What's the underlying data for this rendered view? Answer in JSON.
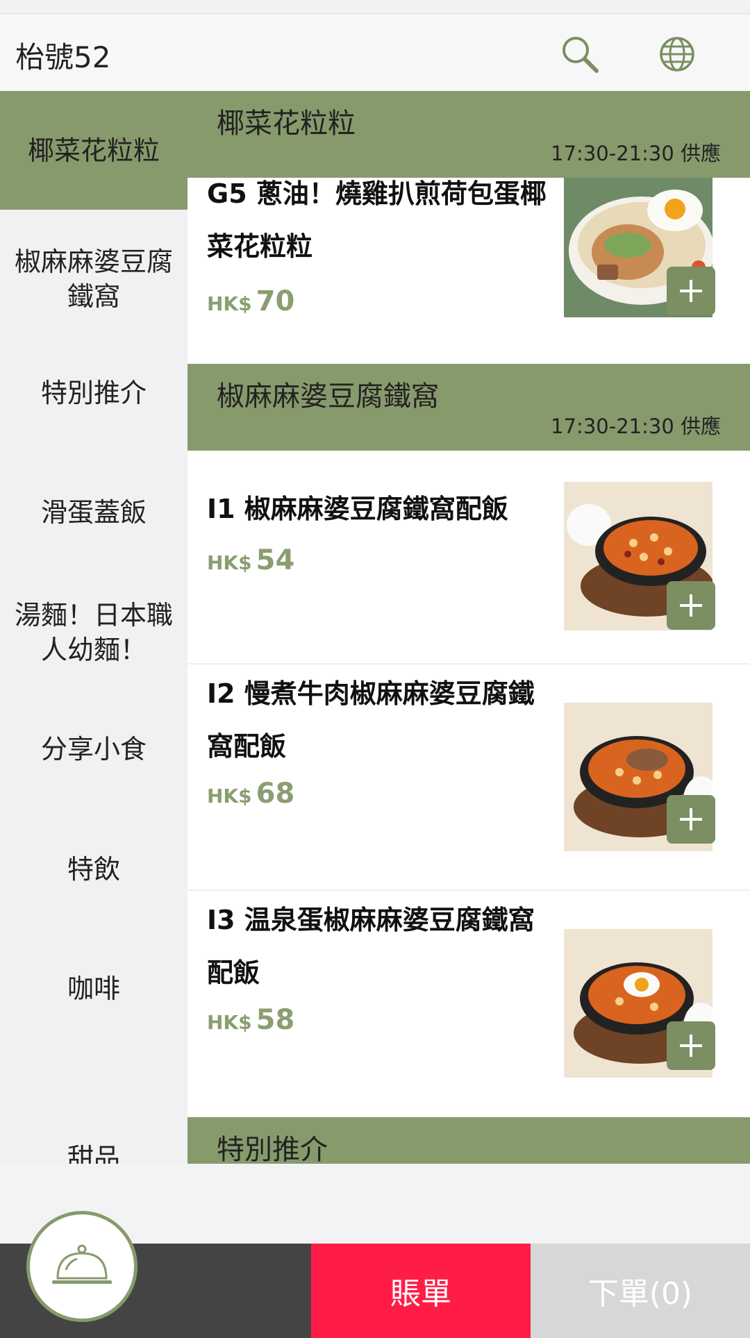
{
  "header": {
    "title": "枱號52",
    "search_icon": "search-icon",
    "language_icon": "globe-icon"
  },
  "sidebar": {
    "items": [
      {
        "label": "椰菜花粒粒",
        "active": true
      },
      {
        "label": "椒麻麻婆豆腐鐵窩",
        "active": false
      },
      {
        "label": "特別推介",
        "active": false
      },
      {
        "label": "滑蛋蓋飯",
        "active": false
      },
      {
        "label": "湯麵！日本職人幼麵！",
        "active": false
      },
      {
        "label": "分享小食",
        "active": false
      },
      {
        "label": "特飲",
        "active": false
      },
      {
        "label": "咖啡",
        "active": false
      },
      {
        "label": "甜品",
        "active": false
      }
    ]
  },
  "sections": [
    {
      "title": "椰菜花粒粒",
      "time": "17:30-21:30 供應",
      "items": [
        {
          "name": "G5 蔥油！燒雞扒煎荷包蛋椰菜花粒粒",
          "currency": "HK$",
          "price": "70"
        }
      ]
    },
    {
      "title": "椒麻麻婆豆腐鐵窩",
      "time": "17:30-21:30 供應",
      "items": [
        {
          "name": "I1 椒麻麻婆豆腐鐵窩配飯",
          "currency": "HK$",
          "price": "54"
        },
        {
          "name": "I2 慢煮牛肉椒麻麻婆豆腐鐵窩配飯",
          "currency": "HK$",
          "price": "68"
        },
        {
          "name": "I3 温泉蛋椒麻麻婆豆腐鐵窩配飯",
          "currency": "HK$",
          "price": "58"
        }
      ]
    },
    {
      "title": "特別推介",
      "time": "",
      "items": []
    }
  ],
  "bottom_bar": {
    "cloche_icon": "cloche-icon",
    "bill_label": "賬單",
    "order_label": "下單(0)"
  },
  "colors": {
    "accent_green": "#879a6c",
    "button_green": "#7b8f62",
    "price_green": "#8a9e70",
    "bill_red": "#ff1d48",
    "order_gray": "#d7d7d7",
    "bottom_dark": "#444444"
  }
}
